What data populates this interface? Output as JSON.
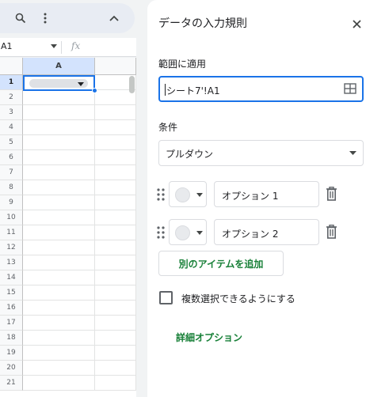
{
  "namebox": {
    "cell_ref": "A1",
    "formula_icon": "fx"
  },
  "grid": {
    "column_header": "A",
    "rows": [
      "1",
      "2",
      "3",
      "4",
      "5",
      "6",
      "7",
      "8",
      "9",
      "10",
      "11",
      "12",
      "13",
      "14",
      "15",
      "16",
      "17",
      "18",
      "19",
      "20",
      "21"
    ]
  },
  "panel": {
    "title": "データの入力規則",
    "range_label": "範囲に適用",
    "range_value": "シート7'!A1",
    "criteria_label": "条件",
    "criteria_value": "プルダウン",
    "options": [
      {
        "value": "オプション 1"
      },
      {
        "value": "オプション 2"
      }
    ],
    "add_item_label": "別のアイテムを追加",
    "multi_select_label": "複数選択できるようにする",
    "advanced_label": "詳細オプション"
  },
  "colors": {
    "accent": "#1a73e8",
    "green": "#188038"
  }
}
